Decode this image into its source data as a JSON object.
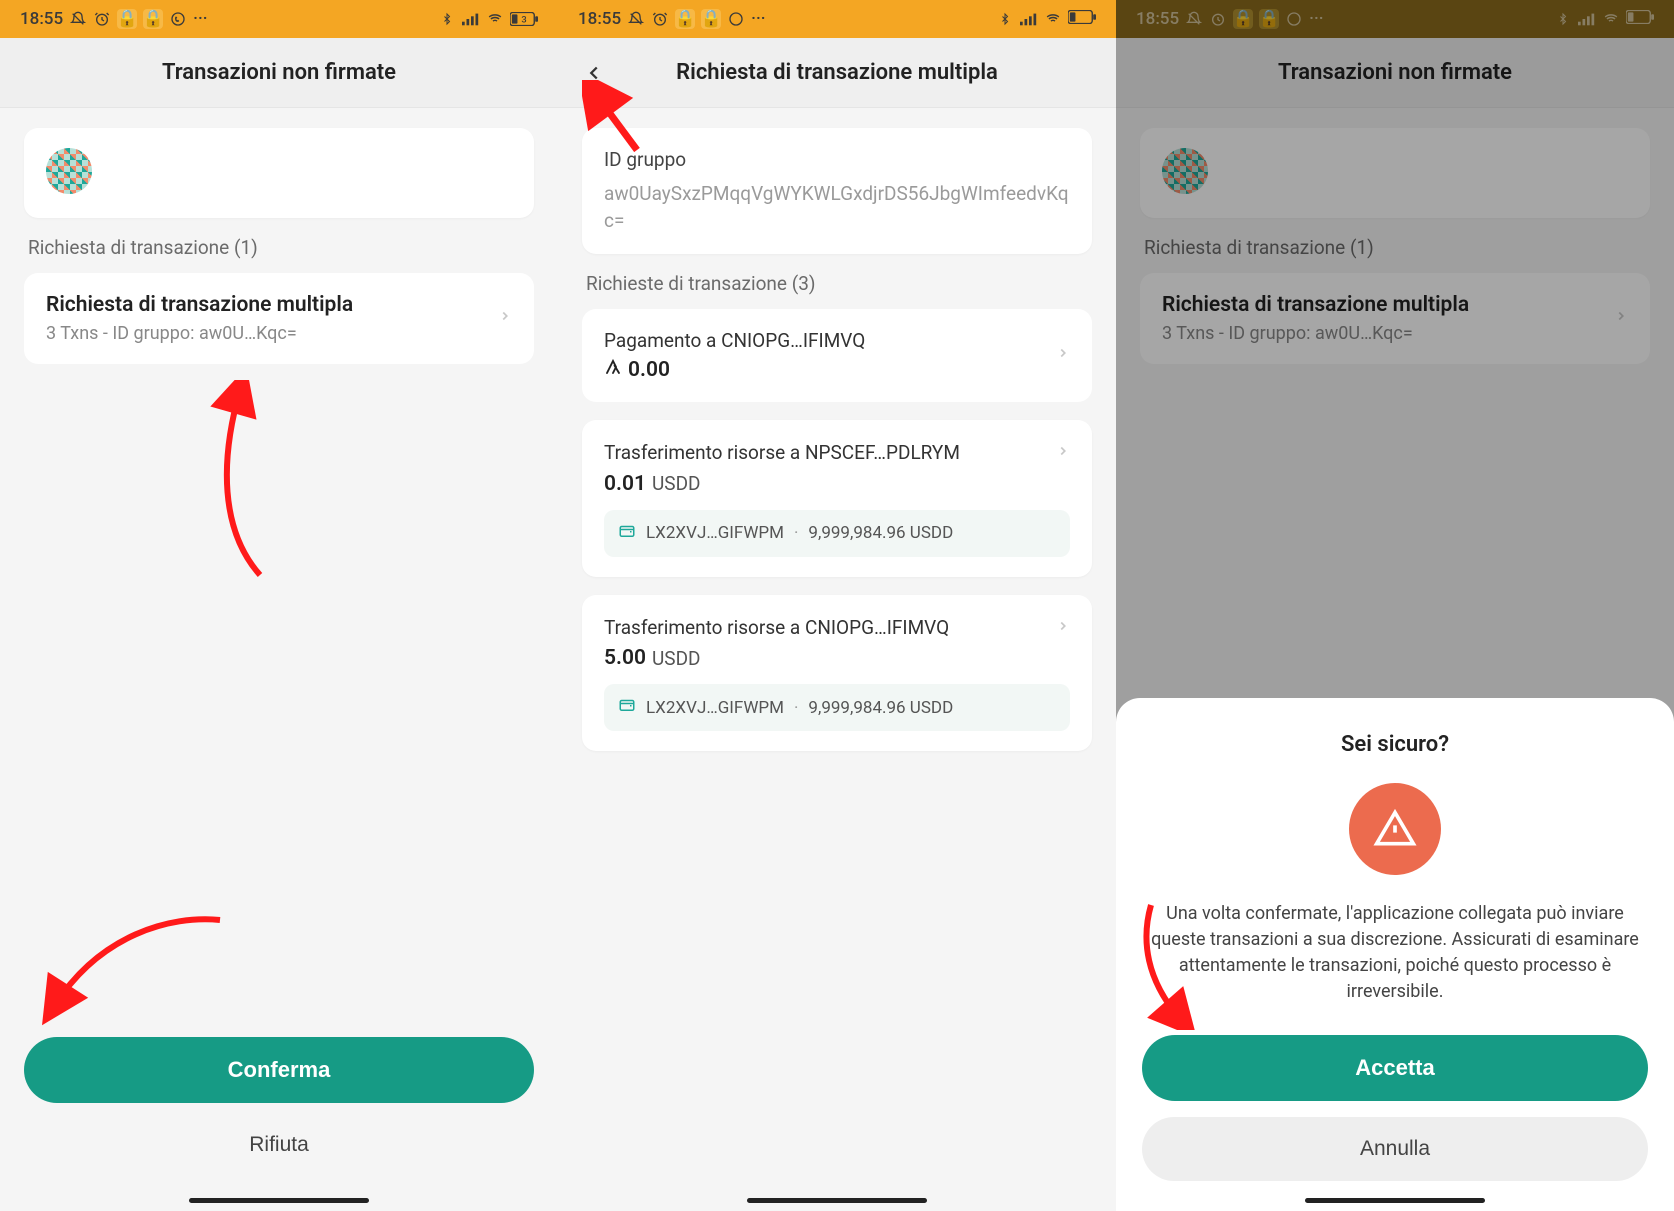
{
  "status": {
    "time": "18:55",
    "battery": "3"
  },
  "screen1": {
    "title": "Transazioni non firmate",
    "section": "Richiesta di transazione (1)",
    "item": {
      "title": "Richiesta di transazione multipla",
      "sub": "3 Txns - ID gruppo: aw0U…Kqc="
    },
    "confirm": "Conferma",
    "reject": "Rifiuta"
  },
  "screen2": {
    "title": "Richiesta di transazione multipla",
    "group_label": "ID gruppo",
    "group_id": "aw0UaySxzPMqqVgWYKWLGxdjrDS56JbgWImfeedvKqc=",
    "section": "Richieste di transazione (3)",
    "items": [
      {
        "title": "Pagamento a CNIOPG…IFIMVQ",
        "amount": "0.00",
        "currency_icon": "algo"
      },
      {
        "title": "Trasferimento risorse a NPSCEF…PDLRYM",
        "amount": "0.01",
        "currency": "USDD",
        "wallet": "LX2XVJ…GIFWPM",
        "balance": "9,999,984.96 USDD"
      },
      {
        "title": "Trasferimento risorse a CNIOPG…IFIMVQ",
        "amount": "5.00",
        "currency": "USDD",
        "wallet": "LX2XVJ…GIFWPM",
        "balance": "9,999,984.96 USDD"
      }
    ]
  },
  "screen3": {
    "title": "Transazioni non firmate",
    "section": "Richiesta di transazione (1)",
    "item": {
      "title": "Richiesta di transazione multipla",
      "sub": "3 Txns - ID gruppo: aw0U…Kqc="
    },
    "dialog": {
      "title": "Sei sicuro?",
      "body": "Una volta confermate, l'applicazione collegata può inviare queste transazioni a sua discrezione. Assicurati di esaminare attentamente le transazioni, poiché questo processo è irreversibile.",
      "accept": "Accetta",
      "cancel": "Annulla"
    }
  }
}
